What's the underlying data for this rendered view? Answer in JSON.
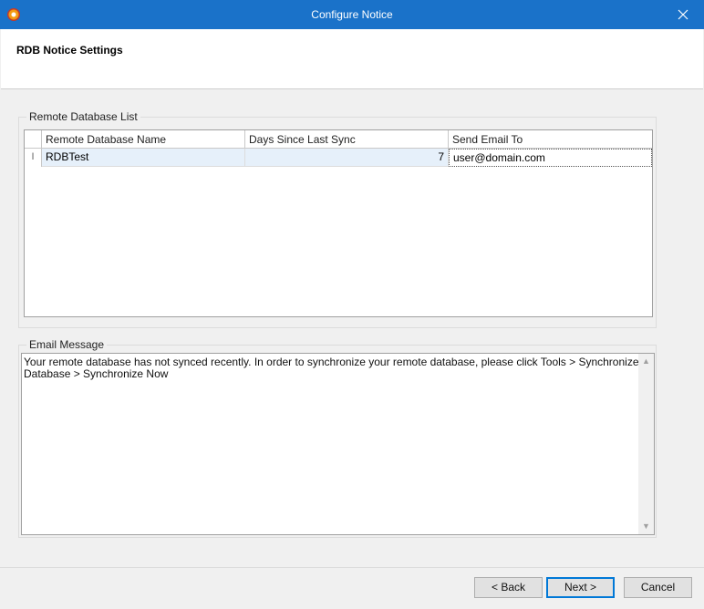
{
  "window": {
    "title": "Configure Notice"
  },
  "header": {
    "title": "RDB Notice Settings"
  },
  "remote_db": {
    "legend": "Remote Database List",
    "columns": [
      "Remote Database Name",
      "Days Since Last Sync",
      "Send Email To"
    ],
    "rows": [
      {
        "indicator": "I",
        "name": "RDBTest",
        "days": "7",
        "email": "user@domain.com"
      }
    ]
  },
  "email_message": {
    "legend": "Email Message",
    "text": "Your remote database has not synced recently. In order to synchronize your remote database, please click Tools > Synchronize Database > Synchronize Now"
  },
  "buttons": {
    "back": "< Back",
    "next": "Next >",
    "cancel": "Cancel"
  }
}
